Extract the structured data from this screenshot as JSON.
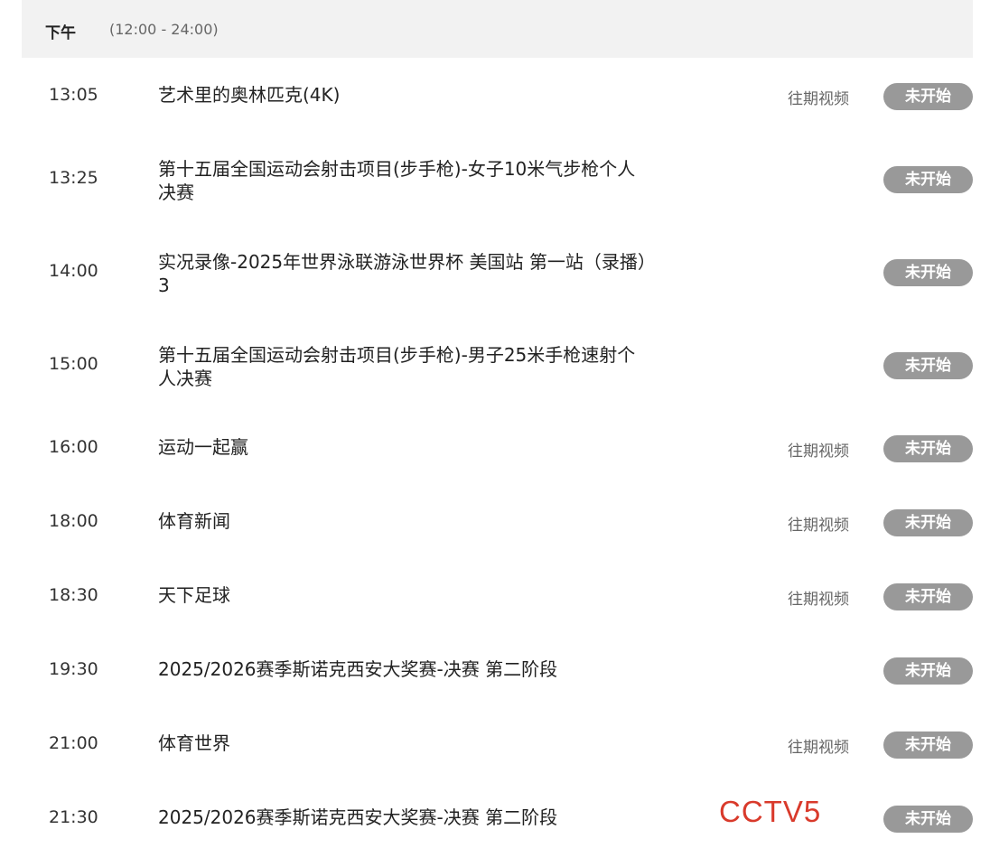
{
  "header": {
    "title": "下午",
    "range": "(12:00 - 24:00)"
  },
  "programs": [
    {
      "time": "13:05",
      "title": "艺术里的奥林匹克(4K)",
      "replay": "往期视频",
      "status": "未开始"
    },
    {
      "time": "13:25",
      "title": "第十五届全国运动会射击项目(步手枪)-女子10米气步枪个人决赛",
      "replay": "",
      "status": "未开始"
    },
    {
      "time": "14:00",
      "title": "实况录像-2025年世界泳联游泳世界杯 美国站 第一站（录播）3",
      "replay": "",
      "status": "未开始"
    },
    {
      "time": "15:00",
      "title": "第十五届全国运动会射击项目(步手枪)-男子25米手枪速射个人决赛",
      "replay": "",
      "status": "未开始"
    },
    {
      "time": "16:00",
      "title": "运动一起赢",
      "replay": "往期视频",
      "status": "未开始"
    },
    {
      "time": "18:00",
      "title": "体育新闻",
      "replay": "往期视频",
      "status": "未开始"
    },
    {
      "time": "18:30",
      "title": "天下足球",
      "replay": "往期视频",
      "status": "未开始"
    },
    {
      "time": "19:30",
      "title": "2025/2026赛季斯诺克西安大奖赛-决赛 第二阶段",
      "replay": "",
      "status": "未开始"
    },
    {
      "time": "21:00",
      "title": "体育世界",
      "replay": "往期视频",
      "status": "未开始"
    },
    {
      "time": "21:30",
      "title": "2025/2026赛季斯诺克西安大奖赛-决赛 第二阶段",
      "replay": "",
      "status": "未开始"
    }
  ],
  "watermark": "CCTV5",
  "colors": {
    "status_bg": "#999999",
    "watermark": "#d93a2b",
    "header_bg": "#f2f2f2"
  }
}
